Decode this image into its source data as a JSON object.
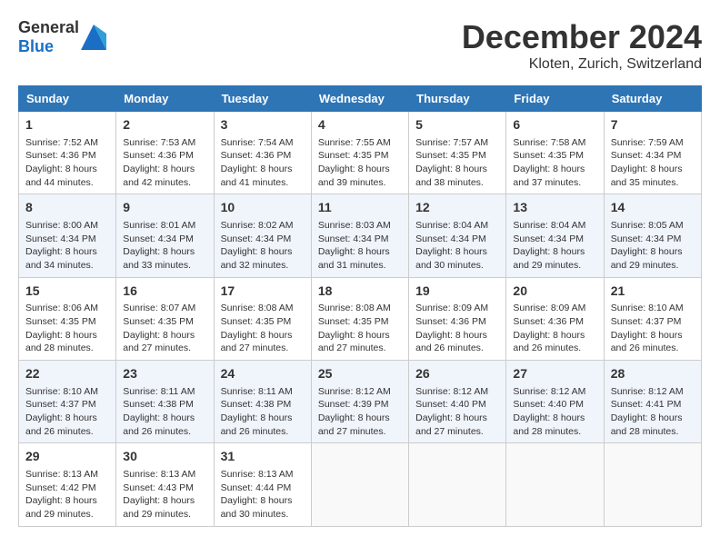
{
  "header": {
    "logo_general": "General",
    "logo_blue": "Blue",
    "month": "December 2024",
    "location": "Kloten, Zurich, Switzerland"
  },
  "days_of_week": [
    "Sunday",
    "Monday",
    "Tuesday",
    "Wednesday",
    "Thursday",
    "Friday",
    "Saturday"
  ],
  "weeks": [
    [
      {
        "day": "1",
        "sunrise": "Sunrise: 7:52 AM",
        "sunset": "Sunset: 4:36 PM",
        "daylight": "Daylight: 8 hours and 44 minutes."
      },
      {
        "day": "2",
        "sunrise": "Sunrise: 7:53 AM",
        "sunset": "Sunset: 4:36 PM",
        "daylight": "Daylight: 8 hours and 42 minutes."
      },
      {
        "day": "3",
        "sunrise": "Sunrise: 7:54 AM",
        "sunset": "Sunset: 4:36 PM",
        "daylight": "Daylight: 8 hours and 41 minutes."
      },
      {
        "day": "4",
        "sunrise": "Sunrise: 7:55 AM",
        "sunset": "Sunset: 4:35 PM",
        "daylight": "Daylight: 8 hours and 39 minutes."
      },
      {
        "day": "5",
        "sunrise": "Sunrise: 7:57 AM",
        "sunset": "Sunset: 4:35 PM",
        "daylight": "Daylight: 8 hours and 38 minutes."
      },
      {
        "day": "6",
        "sunrise": "Sunrise: 7:58 AM",
        "sunset": "Sunset: 4:35 PM",
        "daylight": "Daylight: 8 hours and 37 minutes."
      },
      {
        "day": "7",
        "sunrise": "Sunrise: 7:59 AM",
        "sunset": "Sunset: 4:34 PM",
        "daylight": "Daylight: 8 hours and 35 minutes."
      }
    ],
    [
      {
        "day": "8",
        "sunrise": "Sunrise: 8:00 AM",
        "sunset": "Sunset: 4:34 PM",
        "daylight": "Daylight: 8 hours and 34 minutes."
      },
      {
        "day": "9",
        "sunrise": "Sunrise: 8:01 AM",
        "sunset": "Sunset: 4:34 PM",
        "daylight": "Daylight: 8 hours and 33 minutes."
      },
      {
        "day": "10",
        "sunrise": "Sunrise: 8:02 AM",
        "sunset": "Sunset: 4:34 PM",
        "daylight": "Daylight: 8 hours and 32 minutes."
      },
      {
        "day": "11",
        "sunrise": "Sunrise: 8:03 AM",
        "sunset": "Sunset: 4:34 PM",
        "daylight": "Daylight: 8 hours and 31 minutes."
      },
      {
        "day": "12",
        "sunrise": "Sunrise: 8:04 AM",
        "sunset": "Sunset: 4:34 PM",
        "daylight": "Daylight: 8 hours and 30 minutes."
      },
      {
        "day": "13",
        "sunrise": "Sunrise: 8:04 AM",
        "sunset": "Sunset: 4:34 PM",
        "daylight": "Daylight: 8 hours and 29 minutes."
      },
      {
        "day": "14",
        "sunrise": "Sunrise: 8:05 AM",
        "sunset": "Sunset: 4:34 PM",
        "daylight": "Daylight: 8 hours and 29 minutes."
      }
    ],
    [
      {
        "day": "15",
        "sunrise": "Sunrise: 8:06 AM",
        "sunset": "Sunset: 4:35 PM",
        "daylight": "Daylight: 8 hours and 28 minutes."
      },
      {
        "day": "16",
        "sunrise": "Sunrise: 8:07 AM",
        "sunset": "Sunset: 4:35 PM",
        "daylight": "Daylight: 8 hours and 27 minutes."
      },
      {
        "day": "17",
        "sunrise": "Sunrise: 8:08 AM",
        "sunset": "Sunset: 4:35 PM",
        "daylight": "Daylight: 8 hours and 27 minutes."
      },
      {
        "day": "18",
        "sunrise": "Sunrise: 8:08 AM",
        "sunset": "Sunset: 4:35 PM",
        "daylight": "Daylight: 8 hours and 27 minutes."
      },
      {
        "day": "19",
        "sunrise": "Sunrise: 8:09 AM",
        "sunset": "Sunset: 4:36 PM",
        "daylight": "Daylight: 8 hours and 26 minutes."
      },
      {
        "day": "20",
        "sunrise": "Sunrise: 8:09 AM",
        "sunset": "Sunset: 4:36 PM",
        "daylight": "Daylight: 8 hours and 26 minutes."
      },
      {
        "day": "21",
        "sunrise": "Sunrise: 8:10 AM",
        "sunset": "Sunset: 4:37 PM",
        "daylight": "Daylight: 8 hours and 26 minutes."
      }
    ],
    [
      {
        "day": "22",
        "sunrise": "Sunrise: 8:10 AM",
        "sunset": "Sunset: 4:37 PM",
        "daylight": "Daylight: 8 hours and 26 minutes."
      },
      {
        "day": "23",
        "sunrise": "Sunrise: 8:11 AM",
        "sunset": "Sunset: 4:38 PM",
        "daylight": "Daylight: 8 hours and 26 minutes."
      },
      {
        "day": "24",
        "sunrise": "Sunrise: 8:11 AM",
        "sunset": "Sunset: 4:38 PM",
        "daylight": "Daylight: 8 hours and 26 minutes."
      },
      {
        "day": "25",
        "sunrise": "Sunrise: 8:12 AM",
        "sunset": "Sunset: 4:39 PM",
        "daylight": "Daylight: 8 hours and 27 minutes."
      },
      {
        "day": "26",
        "sunrise": "Sunrise: 8:12 AM",
        "sunset": "Sunset: 4:40 PM",
        "daylight": "Daylight: 8 hours and 27 minutes."
      },
      {
        "day": "27",
        "sunrise": "Sunrise: 8:12 AM",
        "sunset": "Sunset: 4:40 PM",
        "daylight": "Daylight: 8 hours and 28 minutes."
      },
      {
        "day": "28",
        "sunrise": "Sunrise: 8:12 AM",
        "sunset": "Sunset: 4:41 PM",
        "daylight": "Daylight: 8 hours and 28 minutes."
      }
    ],
    [
      {
        "day": "29",
        "sunrise": "Sunrise: 8:13 AM",
        "sunset": "Sunset: 4:42 PM",
        "daylight": "Daylight: 8 hours and 29 minutes."
      },
      {
        "day": "30",
        "sunrise": "Sunrise: 8:13 AM",
        "sunset": "Sunset: 4:43 PM",
        "daylight": "Daylight: 8 hours and 29 minutes."
      },
      {
        "day": "31",
        "sunrise": "Sunrise: 8:13 AM",
        "sunset": "Sunset: 4:44 PM",
        "daylight": "Daylight: 8 hours and 30 minutes."
      },
      null,
      null,
      null,
      null
    ]
  ]
}
